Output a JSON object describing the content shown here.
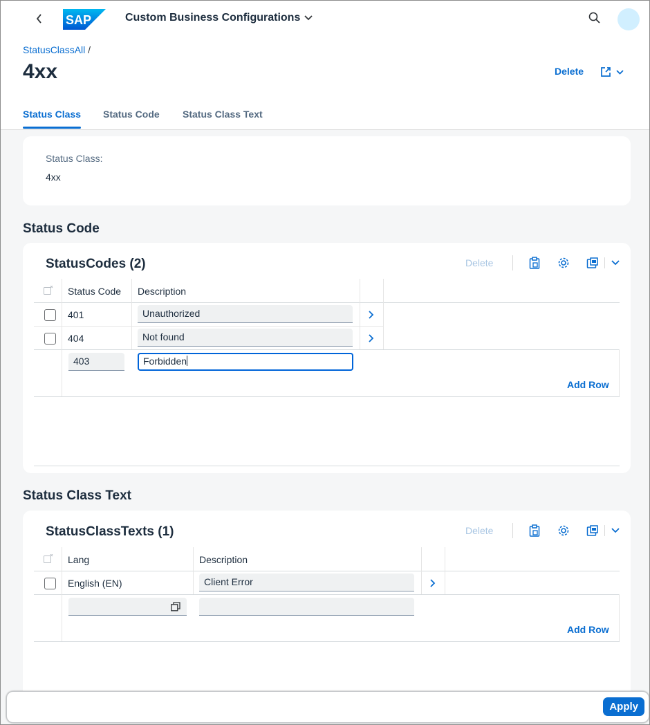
{
  "shell": {
    "app_title": "Custom Business Configurations",
    "logo_text": "SAP",
    "icons": {
      "back": "chevron-left-icon",
      "title_menu": "chevron-down-icon",
      "search": "search-icon"
    }
  },
  "header": {
    "breadcrumb": "StatusClassAll",
    "breadcrumb_sep": "/",
    "title": "4xx",
    "delete_label": "Delete",
    "share_icon": "share-icon"
  },
  "tabs": [
    {
      "label": "Status Class",
      "active": true
    },
    {
      "label": "Status Code",
      "active": false
    },
    {
      "label": "Status Class Text",
      "active": false
    }
  ],
  "status_class": {
    "field_label": "Status Class:",
    "field_value": "4xx"
  },
  "status_code_section": {
    "title": "Status Code",
    "table_title": "StatusCodes (2)",
    "delete_label": "Delete",
    "columns": [
      "Status Code",
      "Description"
    ],
    "rows": [
      {
        "code": "401",
        "description": "Unauthorized"
      },
      {
        "code": "404",
        "description": "Not found"
      }
    ],
    "new_row": {
      "code": "403",
      "description": "Forbidden"
    },
    "add_row_label": "Add Row"
  },
  "status_class_text_section": {
    "title": "Status Class Text",
    "table_title": "StatusClassTexts (1)",
    "delete_label": "Delete",
    "columns": [
      "Lang",
      "Description"
    ],
    "rows": [
      {
        "lang": "English (EN)",
        "description": "Client Error"
      }
    ],
    "new_row": {
      "lang": "",
      "description": ""
    },
    "add_row_label": "Add Row"
  },
  "footer": {
    "apply_label": "Apply"
  },
  "colors": {
    "accent": "#0a6ed1",
    "background": "#f5f6f7",
    "avatar": "#d1efff"
  }
}
